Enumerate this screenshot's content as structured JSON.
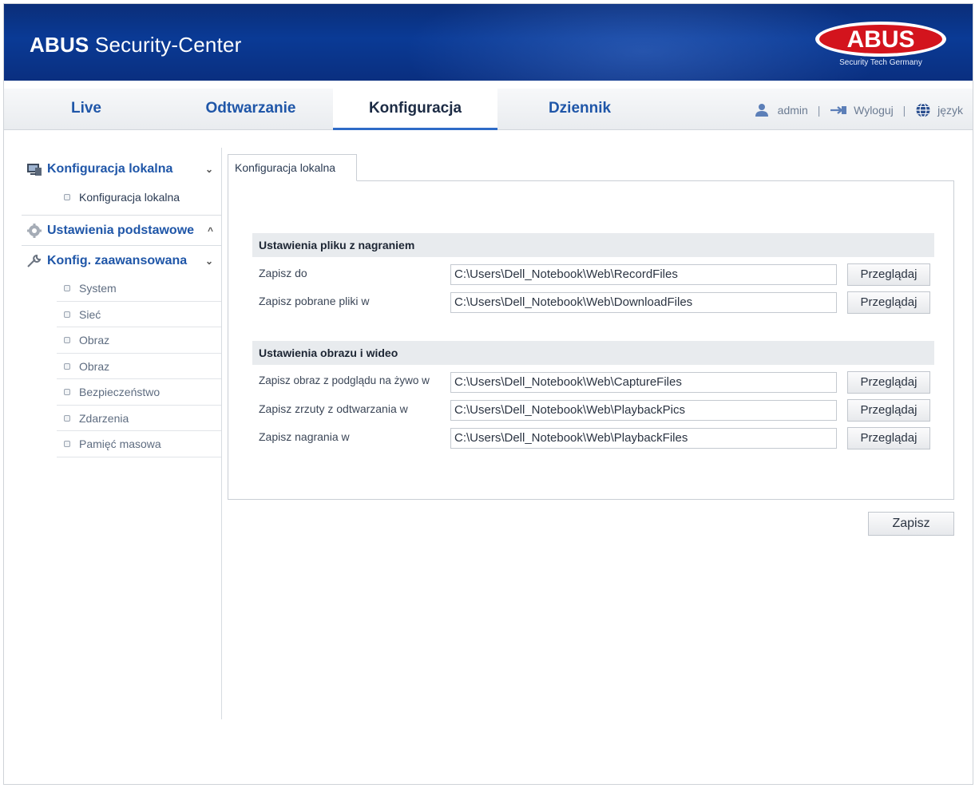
{
  "header": {
    "title_bold": "ABUS",
    "title_rest": " Security-Center",
    "logo_text": "ABUS",
    "logo_tagline": "Security Tech Germany"
  },
  "nav": {
    "tabs": [
      {
        "label": "Live",
        "active": false
      },
      {
        "label": "Odtwarzanie",
        "active": false
      },
      {
        "label": "Konfiguracja",
        "active": true
      },
      {
        "label": "Dziennik",
        "active": false
      }
    ],
    "user": "admin",
    "logout": "Wyloguj",
    "language": "język",
    "separator": "|"
  },
  "sidebar": {
    "sections": [
      {
        "label": "Konfiguracja lokalna",
        "icon": "monitor-icon",
        "chevron": "⌄",
        "items": [
          "Konfiguracja lokalna"
        ]
      },
      {
        "label": "Ustawienia podstawowe",
        "icon": "gear-icon",
        "chevron": "^",
        "items": []
      },
      {
        "label": "Konfig. zaawansowana",
        "icon": "wrench-icon",
        "chevron": "⌄",
        "items": [
          "System",
          "Sieć",
          "Obraz",
          "Obraz",
          "Bezpieczeństwo",
          "Zdarzenia",
          "Pamięć masowa"
        ]
      }
    ]
  },
  "main": {
    "tab": "Konfiguracja lokalna",
    "groups": [
      {
        "title": "Ustawienia pliku z nagraniem",
        "rows": [
          {
            "label": "Zapisz do",
            "value": "C:\\Users\\Dell_Notebook\\Web\\RecordFiles",
            "button": "Przeglądaj"
          },
          {
            "label": "Zapisz pobrane pliki w",
            "value": "C:\\Users\\Dell_Notebook\\Web\\DownloadFiles",
            "button": "Przeglądaj"
          }
        ]
      },
      {
        "title": "Ustawienia obrazu i wideo",
        "rows": [
          {
            "label": "Zapisz obraz z podglądu na żywo w",
            "value": "C:\\Users\\Dell_Notebook\\Web\\CaptureFiles",
            "button": "Przeglądaj"
          },
          {
            "label": "Zapisz zrzuty z odtwarzania w",
            "value": "C:\\Users\\Dell_Notebook\\Web\\PlaybackPics",
            "button": "Przeglądaj"
          },
          {
            "label": "Zapisz nagrania w",
            "value": "C:\\Users\\Dell_Notebook\\Web\\PlaybackFiles",
            "button": "Przeglądaj"
          }
        ]
      }
    ],
    "save_label": "Zapisz"
  },
  "colors": {
    "header_bg": "#0a3a95",
    "nav_link": "#1f56a8",
    "active_tab_underline": "#2e6bc7",
    "logo_red": "#d3141d"
  }
}
